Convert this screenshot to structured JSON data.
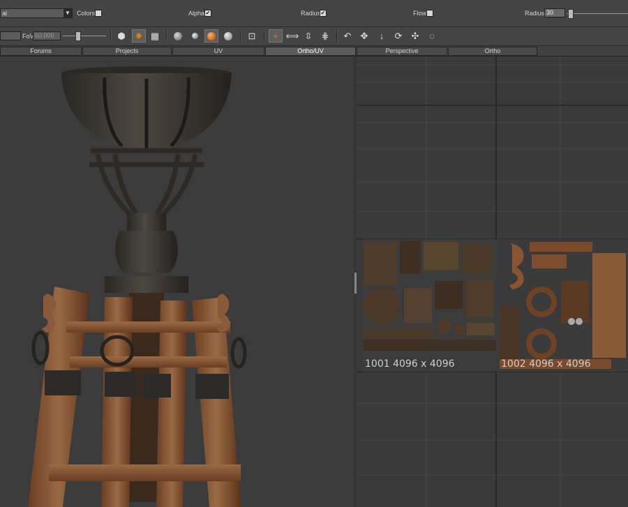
{
  "toolbar_top": {
    "material_dropdown_value": "al",
    "colors_label": "Colors",
    "alpha_label": "Alpha",
    "radius_label": "Radius",
    "flow_label": "Flow",
    "radius2_label": "Radius",
    "radius2_value": "30",
    "alpha_checked": "✔",
    "radius_checked": "✔"
  },
  "toolbar_second": {
    "fov_label": "FoV",
    "fov_value": "60.000"
  },
  "tabs": [
    {
      "label": "Forums"
    },
    {
      "label": "Projects"
    },
    {
      "label": "UV"
    },
    {
      "label": "Ortho/UV"
    },
    {
      "label": "Perspective"
    },
    {
      "label": "Ortho"
    }
  ],
  "active_tab": "Ortho/UV",
  "uv_tiles": [
    {
      "label": "1001 4096 x 4096"
    },
    {
      "label": "1002 4096 x 4096"
    }
  ],
  "colors": {
    "accent_orange": "#e07a1a",
    "wood": "#7a4a2a",
    "iron": "#3b3630"
  },
  "icons": [
    "chevron-down-icon",
    "cube-icon",
    "brush-icon",
    "uv-grid-icon",
    "sphere-icon",
    "orange-sphere-icon",
    "frame-icon",
    "plus-icon",
    "move-icon",
    "undo-icon",
    "rotate-icon",
    "scale-icon",
    "lasso-icon"
  ]
}
